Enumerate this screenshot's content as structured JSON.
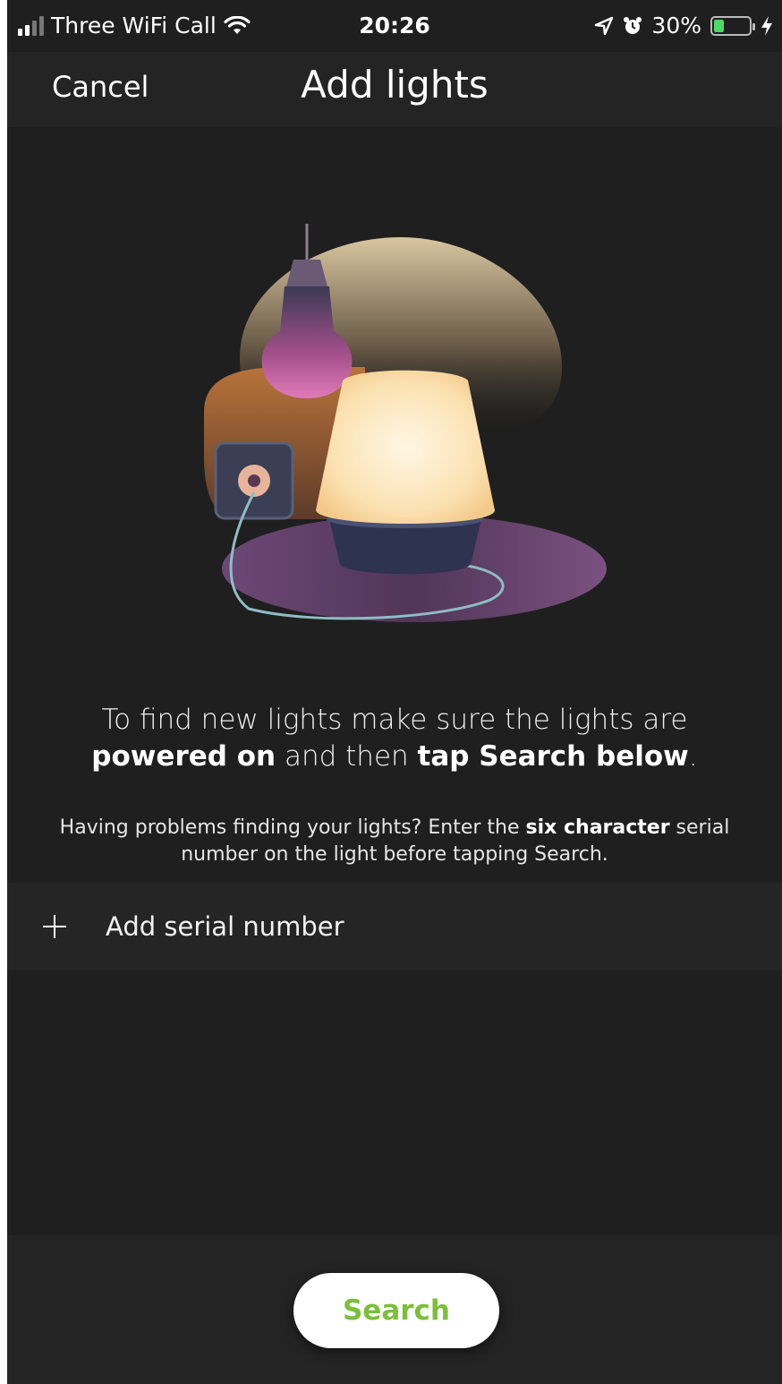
{
  "colors": {
    "background": "#1f1f1f",
    "accent_green": "#7bbf3b",
    "battery_green": "#4cd964"
  },
  "status_bar": {
    "carrier": "Three WiFi Call",
    "time": "20:26",
    "battery_percent": "30%",
    "battery_level": 0.3,
    "icons": [
      "signal-icon",
      "wifi-icon",
      "location-arrow-icon",
      "alarm-icon",
      "battery-icon",
      "charging-bolt-icon"
    ]
  },
  "nav": {
    "cancel_label": "Cancel",
    "title": "Add lights"
  },
  "instructions": {
    "part1": "To find new lights make sure the lights are ",
    "bold1": "powered on",
    "part2": " and then ",
    "bold2": "tap Search below",
    "part3": "."
  },
  "help": {
    "part1": "Having problems finding your lights? Enter the ",
    "bold": "six character",
    "part2": " serial number on the light before tapping Search."
  },
  "serial": {
    "label": "Add serial number"
  },
  "search_button": {
    "label": "Search"
  }
}
